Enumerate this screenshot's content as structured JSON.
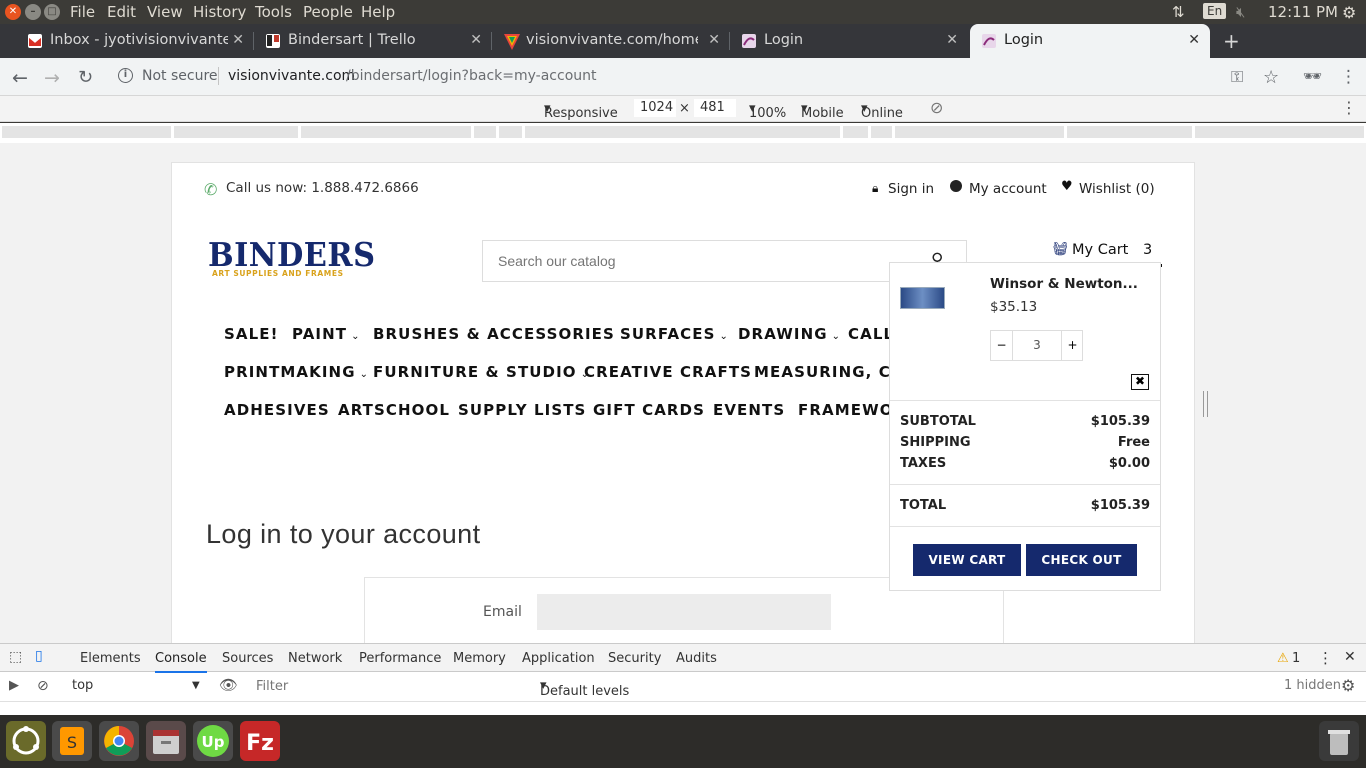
{
  "system_menubar": {
    "menus": [
      "File",
      "Edit",
      "View",
      "History",
      "Tools",
      "People",
      "Help"
    ],
    "keyboard_layout": "En",
    "clock": "12:11 PM"
  },
  "tabs": [
    {
      "title": "Inbox - jyotivisionvivante",
      "favicon": "gmail-icon",
      "favicon_color": "#d93025",
      "active": false
    },
    {
      "title": "Bindersart | Trello",
      "favicon": "trello-icon",
      "favicon_color": "#0079bf",
      "active": false
    },
    {
      "title": "visionvivante.com/home/",
      "favicon": "visionvivante-icon",
      "favicon_color": "#e8453c",
      "active": false
    },
    {
      "title": "Login",
      "favicon": "binders-icon",
      "favicon_color": "#8b2b7a",
      "active": false
    },
    {
      "title": "Login",
      "favicon": "binders-icon",
      "favicon_color": "#8b2b7a",
      "active": true
    }
  ],
  "address_bar": {
    "security_label": "Not secure",
    "url_domain": "visionvivante.com",
    "url_path": "/bindersart/login?back=my-account"
  },
  "device_toolbar": {
    "mode": "Responsive",
    "width": "1024",
    "times": "×",
    "height": "481",
    "zoom": "100%",
    "device_type": "Mobile",
    "network": "Online"
  },
  "site": {
    "phone_text": "Call us now: 1.888.472.6866",
    "sign_in": "Sign in",
    "my_account": "My account",
    "wishlist": "Wishlist (0)",
    "logo_main": "BINDERS",
    "logo_sub": "ART SUPPLIES AND FRAMES",
    "search_placeholder": "Search our catalog",
    "cart_label": "My Cart",
    "cart_count": "3",
    "brand_color": "#15296d",
    "nav_rows": [
      [
        "SALE!",
        "PAINT",
        "BRUSHES & ACCESSORIES",
        "SURFACES",
        "DRAWING",
        "CALL"
      ],
      [
        "PRINTMAKING",
        "FURNITURE & STUDIO",
        "CREATIVE CRAFTS",
        "MEASURING, CUT"
      ],
      [
        "ADHESIVES",
        "ARTSCHOOL",
        "SUPPLY LISTS",
        "GIFT CARDS",
        "EVENTS",
        "FRAMEWOR"
      ]
    ],
    "login_heading": "Log in to your account",
    "email_label": "Email"
  },
  "cart_dropdown": {
    "product_name": "Winsor & Newton...",
    "product_price": "$35.13",
    "quantity": "3",
    "minus": "−",
    "plus": "+",
    "subtotal_label": "SUBTOTAL",
    "subtotal_value": "$105.39",
    "shipping_label": "SHIPPING",
    "shipping_value": "Free",
    "taxes_label": "TAXES",
    "taxes_value": "$0.00",
    "total_label": "TOTAL",
    "total_value": "$105.39",
    "view_cart": "VIEW CART",
    "check_out": "CHECK OUT"
  },
  "devtools": {
    "tabs": [
      "Elements",
      "Console",
      "Sources",
      "Network",
      "Performance",
      "Memory",
      "Application",
      "Security",
      "Audits"
    ],
    "active_tab": "Console",
    "warning_count": "1",
    "context": "top",
    "filter_placeholder": "Filter",
    "levels": "Default levels",
    "hidden": "1 hidden"
  }
}
